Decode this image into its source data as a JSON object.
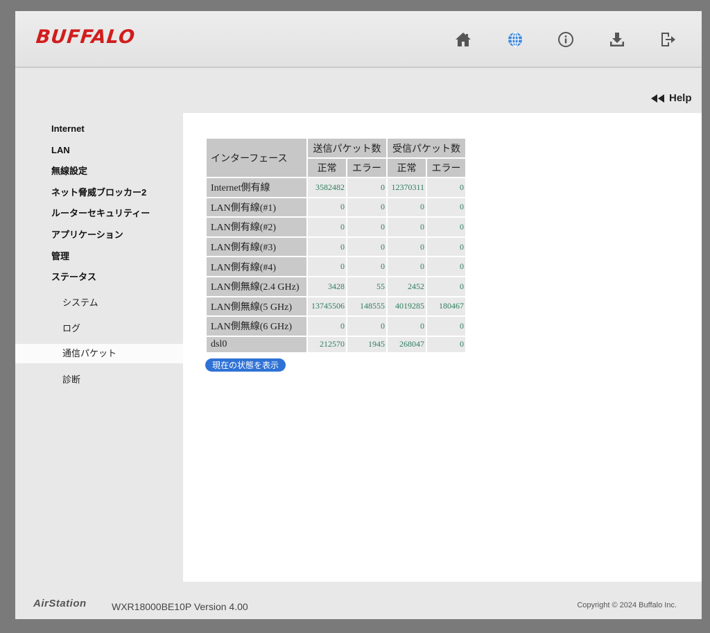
{
  "header": {
    "logo": "BUFFALO",
    "icons": [
      "home-icon",
      "globe-icon",
      "info-icon",
      "download-icon",
      "logout-icon"
    ]
  },
  "help": {
    "label": "Help"
  },
  "sidebar": {
    "items": [
      {
        "label": "Internet"
      },
      {
        "label": "LAN"
      },
      {
        "label": "無線設定"
      },
      {
        "label": "ネット脅威ブロッカー2"
      },
      {
        "label": "ルーターセキュリティー"
      },
      {
        "label": "アプリケーション"
      },
      {
        "label": "管理"
      },
      {
        "label": "ステータス"
      }
    ],
    "subitems": [
      {
        "label": "システム"
      },
      {
        "label": "ログ"
      },
      {
        "label": "通信パケット"
      },
      {
        "label": "診断"
      }
    ]
  },
  "table": {
    "iface_header": "インターフェース",
    "send_header": "送信パケット数",
    "recv_header": "受信パケット数",
    "ok_header": "正常",
    "err_header": "エラー",
    "rows": [
      {
        "name": "Internet側有線",
        "tx_ok": "3582482",
        "tx_err": "0",
        "rx_ok": "12370311",
        "rx_err": "0"
      },
      {
        "name": "LAN側有線(#1)",
        "tx_ok": "0",
        "tx_err": "0",
        "rx_ok": "0",
        "rx_err": "0"
      },
      {
        "name": "LAN側有線(#2)",
        "tx_ok": "0",
        "tx_err": "0",
        "rx_ok": "0",
        "rx_err": "0"
      },
      {
        "name": "LAN側有線(#3)",
        "tx_ok": "0",
        "tx_err": "0",
        "rx_ok": "0",
        "rx_err": "0"
      },
      {
        "name": "LAN側有線(#4)",
        "tx_ok": "0",
        "tx_err": "0",
        "rx_ok": "0",
        "rx_err": "0"
      },
      {
        "name": "LAN側無線(2.4 GHz)",
        "tx_ok": "3428",
        "tx_err": "55",
        "rx_ok": "2452",
        "rx_err": "0"
      },
      {
        "name": "LAN側無線(5 GHz)",
        "tx_ok": "13745506",
        "tx_err": "148555",
        "rx_ok": "4019285",
        "rx_err": "180467"
      },
      {
        "name": "LAN側無線(6 GHz)",
        "tx_ok": "0",
        "tx_err": "0",
        "rx_ok": "0",
        "rx_err": "0"
      },
      {
        "name": "dsl0",
        "tx_ok": "212570",
        "tx_err": "1945",
        "rx_ok": "268047",
        "rx_err": "0"
      }
    ]
  },
  "show_button": {
    "label": "現在の状態を表示"
  },
  "footer": {
    "product": "AirStation",
    "model": "WXR18000BE10P   Version 4.00",
    "copyright": "Copyright © 2024 Buffalo Inc."
  },
  "colors": {
    "brand_red": "#d11d1d",
    "globe_blue": "#3a85d8",
    "button_blue": "#2f72d6",
    "value_green": "#2e7d5e"
  }
}
